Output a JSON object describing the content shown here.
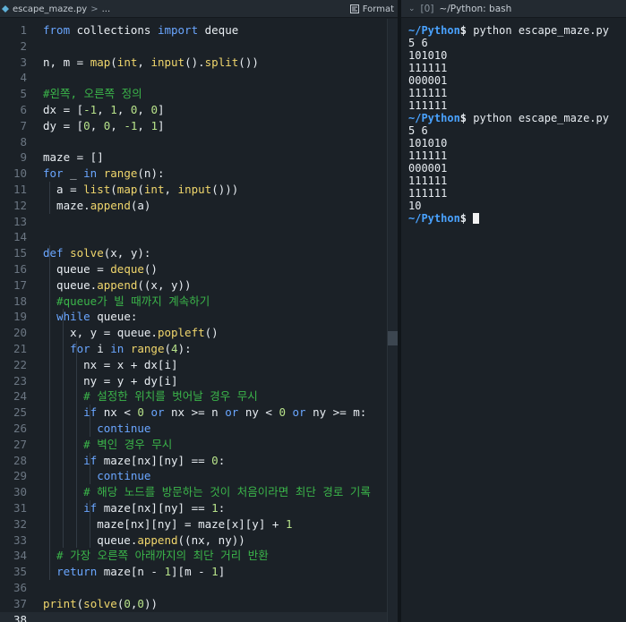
{
  "editor": {
    "file_name": "escape_maze.py",
    "breadcrumb_sep": ">",
    "breadcrumb_more": "...",
    "format_label": "Format",
    "current_line": 38,
    "lines": [
      {
        "n": "1",
        "tokens": [
          [
            "kw",
            "from"
          ],
          [
            "id",
            " collections "
          ],
          [
            "kw",
            "import"
          ],
          [
            "id",
            " deque"
          ]
        ]
      },
      {
        "n": "2",
        "tokens": []
      },
      {
        "n": "3",
        "tokens": [
          [
            "id",
            "n, m = "
          ],
          [
            "fn",
            "map"
          ],
          [
            "id",
            "("
          ],
          [
            "bi",
            "int"
          ],
          [
            "id",
            ", "
          ],
          [
            "fn",
            "input"
          ],
          [
            "id",
            "()."
          ],
          [
            "fn",
            "split"
          ],
          [
            "id",
            "())"
          ]
        ]
      },
      {
        "n": "4",
        "tokens": []
      },
      {
        "n": "5",
        "tokens": [
          [
            "cm",
            "#왼쪽, 오른쪽 정의"
          ]
        ]
      },
      {
        "n": "6",
        "tokens": [
          [
            "id",
            "dx = ["
          ],
          [
            "num",
            "-1"
          ],
          [
            "id",
            ", "
          ],
          [
            "num",
            "1"
          ],
          [
            "id",
            ", "
          ],
          [
            "num",
            "0"
          ],
          [
            "id",
            ", "
          ],
          [
            "num",
            "0"
          ],
          [
            "id",
            "]"
          ]
        ]
      },
      {
        "n": "7",
        "tokens": [
          [
            "id",
            "dy = ["
          ],
          [
            "num",
            "0"
          ],
          [
            "id",
            ", "
          ],
          [
            "num",
            "0"
          ],
          [
            "id",
            ", "
          ],
          [
            "num",
            "-1"
          ],
          [
            "id",
            ", "
          ],
          [
            "num",
            "1"
          ],
          [
            "id",
            "]"
          ]
        ]
      },
      {
        "n": "8",
        "tokens": []
      },
      {
        "n": "9",
        "tokens": [
          [
            "id",
            "maze = []"
          ]
        ]
      },
      {
        "n": "10",
        "tokens": [
          [
            "kw",
            "for"
          ],
          [
            "id",
            " _ "
          ],
          [
            "kw",
            "in"
          ],
          [
            "id",
            " "
          ],
          [
            "fn",
            "range"
          ],
          [
            "id",
            "(n):"
          ]
        ]
      },
      {
        "n": "11",
        "tokens": [
          [
            "id",
            "  a = "
          ],
          [
            "fn",
            "list"
          ],
          [
            "id",
            "("
          ],
          [
            "fn",
            "map"
          ],
          [
            "id",
            "("
          ],
          [
            "bi",
            "int"
          ],
          [
            "id",
            ", "
          ],
          [
            "fn",
            "input"
          ],
          [
            "id",
            "()))"
          ]
        ]
      },
      {
        "n": "12",
        "tokens": [
          [
            "id",
            "  maze."
          ],
          [
            "fn",
            "append"
          ],
          [
            "id",
            "(a)"
          ]
        ]
      },
      {
        "n": "13",
        "tokens": []
      },
      {
        "n": "14",
        "tokens": []
      },
      {
        "n": "15",
        "tokens": [
          [
            "kw",
            "def"
          ],
          [
            "id",
            " "
          ],
          [
            "fn",
            "solve"
          ],
          [
            "id",
            "(x, y):"
          ]
        ]
      },
      {
        "n": "16",
        "tokens": [
          [
            "id",
            "  queue = "
          ],
          [
            "fn",
            "deque"
          ],
          [
            "id",
            "()"
          ]
        ]
      },
      {
        "n": "17",
        "tokens": [
          [
            "id",
            "  queue."
          ],
          [
            "fn",
            "append"
          ],
          [
            "id",
            "((x, y))"
          ]
        ]
      },
      {
        "n": "18",
        "tokens": [
          [
            "cm",
            "  #queue가 빌 때까지 계속하기"
          ]
        ]
      },
      {
        "n": "19",
        "tokens": [
          [
            "id",
            "  "
          ],
          [
            "kw",
            "while"
          ],
          [
            "id",
            " queue:"
          ]
        ]
      },
      {
        "n": "20",
        "tokens": [
          [
            "id",
            "    x, y = queue."
          ],
          [
            "fn",
            "popleft"
          ],
          [
            "id",
            "()"
          ]
        ]
      },
      {
        "n": "21",
        "tokens": [
          [
            "id",
            "    "
          ],
          [
            "kw",
            "for"
          ],
          [
            "id",
            " i "
          ],
          [
            "kw",
            "in"
          ],
          [
            "id",
            " "
          ],
          [
            "fn",
            "range"
          ],
          [
            "id",
            "("
          ],
          [
            "num",
            "4"
          ],
          [
            "id",
            "):"
          ]
        ]
      },
      {
        "n": "22",
        "tokens": [
          [
            "id",
            "      nx = x + dx[i]"
          ]
        ]
      },
      {
        "n": "23",
        "tokens": [
          [
            "id",
            "      ny = y + dy[i]"
          ]
        ]
      },
      {
        "n": "24",
        "tokens": [
          [
            "cm",
            "      # 설정한 위치를 벗어날 경우 무시"
          ]
        ]
      },
      {
        "n": "25",
        "tokens": [
          [
            "id",
            "      "
          ],
          [
            "kw",
            "if"
          ],
          [
            "id",
            " nx < "
          ],
          [
            "num",
            "0"
          ],
          [
            "id",
            " "
          ],
          [
            "kw",
            "or"
          ],
          [
            "id",
            " nx >= n "
          ],
          [
            "kw",
            "or"
          ],
          [
            "id",
            " ny < "
          ],
          [
            "num",
            "0"
          ],
          [
            "id",
            " "
          ],
          [
            "kw",
            "or"
          ],
          [
            "id",
            " ny >= m:"
          ]
        ]
      },
      {
        "n": "26",
        "tokens": [
          [
            "id",
            "        "
          ],
          [
            "kw",
            "continue"
          ]
        ]
      },
      {
        "n": "27",
        "tokens": [
          [
            "cm",
            "      # 벽인 경우 무시"
          ]
        ]
      },
      {
        "n": "28",
        "tokens": [
          [
            "id",
            "      "
          ],
          [
            "kw",
            "if"
          ],
          [
            "id",
            " maze[nx][ny] == "
          ],
          [
            "num",
            "0"
          ],
          [
            "id",
            ":"
          ]
        ]
      },
      {
        "n": "29",
        "tokens": [
          [
            "id",
            "        "
          ],
          [
            "kw",
            "continue"
          ]
        ]
      },
      {
        "n": "30",
        "tokens": [
          [
            "cm",
            "      # 해당 노드를 방문하는 것이 처음이라면 최단 경로 기록"
          ]
        ]
      },
      {
        "n": "31",
        "tokens": [
          [
            "id",
            "      "
          ],
          [
            "kw",
            "if"
          ],
          [
            "id",
            " maze[nx][ny] == "
          ],
          [
            "num",
            "1"
          ],
          [
            "id",
            ":"
          ]
        ]
      },
      {
        "n": "32",
        "tokens": [
          [
            "id",
            "        maze[nx][ny] = maze[x][y] + "
          ],
          [
            "num",
            "1"
          ]
        ]
      },
      {
        "n": "33",
        "tokens": [
          [
            "id",
            "        queue."
          ],
          [
            "fn",
            "append"
          ],
          [
            "id",
            "((nx, ny))"
          ]
        ]
      },
      {
        "n": "34",
        "tokens": [
          [
            "cm",
            "  # 가장 오른쪽 아래까지의 최단 거리 반환"
          ]
        ]
      },
      {
        "n": "35",
        "tokens": [
          [
            "id",
            "  "
          ],
          [
            "kw",
            "return"
          ],
          [
            "id",
            " maze[n - "
          ],
          [
            "num",
            "1"
          ],
          [
            "id",
            "][m - "
          ],
          [
            "num",
            "1"
          ],
          [
            "id",
            "]"
          ]
        ]
      },
      {
        "n": "36",
        "tokens": []
      },
      {
        "n": "37",
        "tokens": [
          [
            "fn",
            "print"
          ],
          [
            "id",
            "("
          ],
          [
            "fn",
            "solve"
          ],
          [
            "id",
            "("
          ],
          [
            "num",
            "0"
          ],
          [
            "id",
            ","
          ],
          [
            "num",
            "0"
          ],
          [
            "id",
            "))"
          ]
        ]
      },
      {
        "n": "38",
        "tokens": []
      }
    ]
  },
  "terminal": {
    "collapse_glyph": "⌄",
    "index": "[0]",
    "title": "~/Python: bash",
    "lines": [
      {
        "type": "prompt",
        "path": "~/Python",
        "sign": "$",
        "cmd": " python escape_maze.py"
      },
      {
        "type": "out",
        "text": "5 6"
      },
      {
        "type": "out",
        "text": "101010"
      },
      {
        "type": "out",
        "text": "111111"
      },
      {
        "type": "out",
        "text": "000001"
      },
      {
        "type": "out",
        "text": "111111"
      },
      {
        "type": "out",
        "text": "111111"
      },
      {
        "type": "prompt",
        "path": "~/Python",
        "sign": "$",
        "cmd": " python escape_maze.py"
      },
      {
        "type": "out",
        "text": "5 6"
      },
      {
        "type": "out",
        "text": "101010"
      },
      {
        "type": "out",
        "text": "111111"
      },
      {
        "type": "out",
        "text": "000001"
      },
      {
        "type": "out",
        "text": "111111"
      },
      {
        "type": "out",
        "text": "111111"
      },
      {
        "type": "out",
        "text": "10"
      },
      {
        "type": "prompt",
        "path": "~/Python",
        "sign": "$",
        "cmd": " ",
        "cursor": true
      }
    ]
  },
  "colors": {
    "keyword": "#6aa6ff",
    "function": "#f0d66c",
    "number": "#b7e28a",
    "comment": "#3bb54a",
    "prompt_path": "#4aa3ff"
  }
}
